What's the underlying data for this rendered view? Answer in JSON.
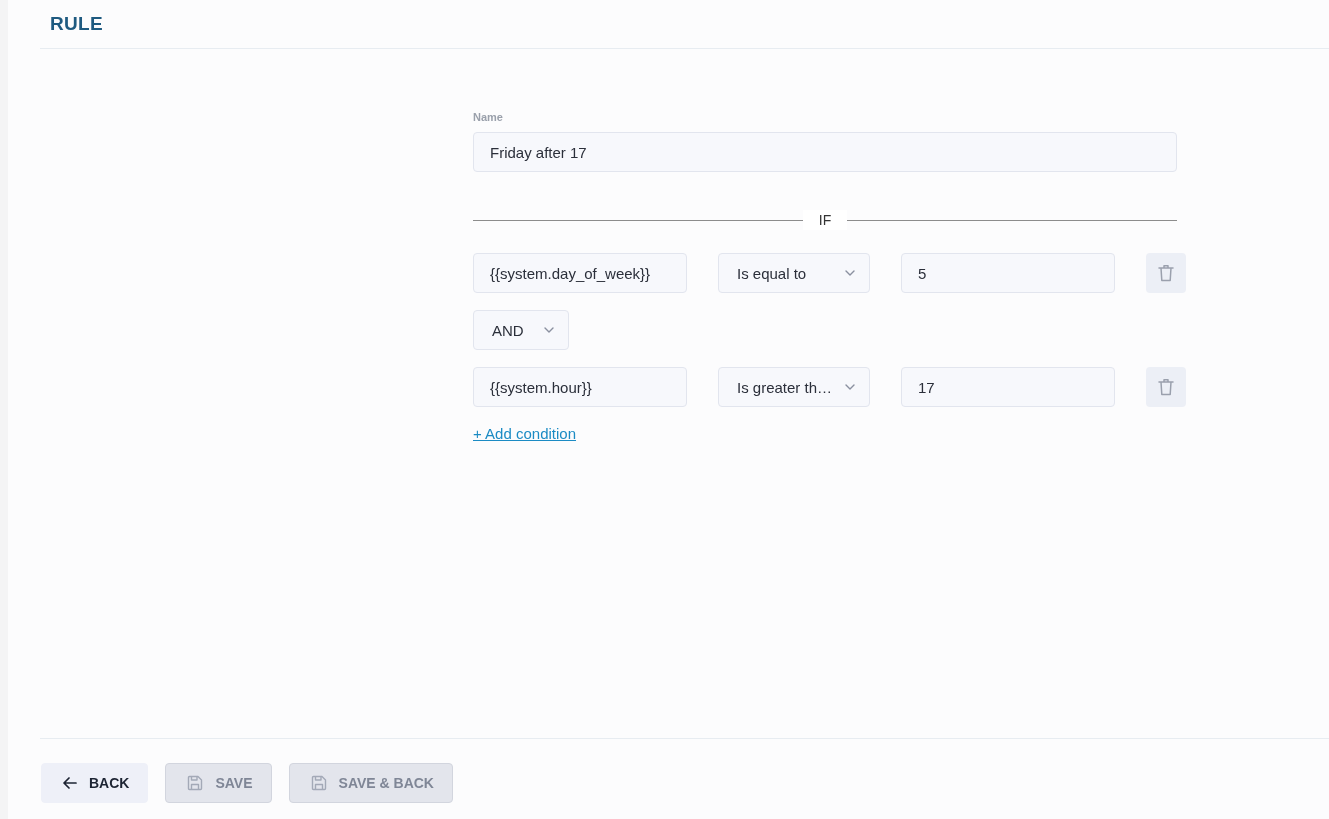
{
  "header": {
    "title": "RULE"
  },
  "form": {
    "name_field": {
      "label": "Name",
      "value": "Friday after 17"
    },
    "divider_label": "IF",
    "conditions": [
      {
        "kind": "condition",
        "variable": "{{system.day_of_week}}",
        "operator": "Is equal to",
        "value": "5"
      },
      {
        "kind": "connector",
        "operator": "AND"
      },
      {
        "kind": "condition",
        "variable": "{{system.hour}}",
        "operator": "Is greater th…",
        "value": "17"
      }
    ],
    "add_link": "+ Add condition"
  },
  "footer": {
    "buttons": [
      {
        "kind": "back",
        "label": "BACK",
        "disabled": false
      },
      {
        "kind": "save",
        "label": "SAVE",
        "disabled": true
      },
      {
        "kind": "save",
        "label": "SAVE & BACK",
        "disabled": true
      }
    ]
  }
}
